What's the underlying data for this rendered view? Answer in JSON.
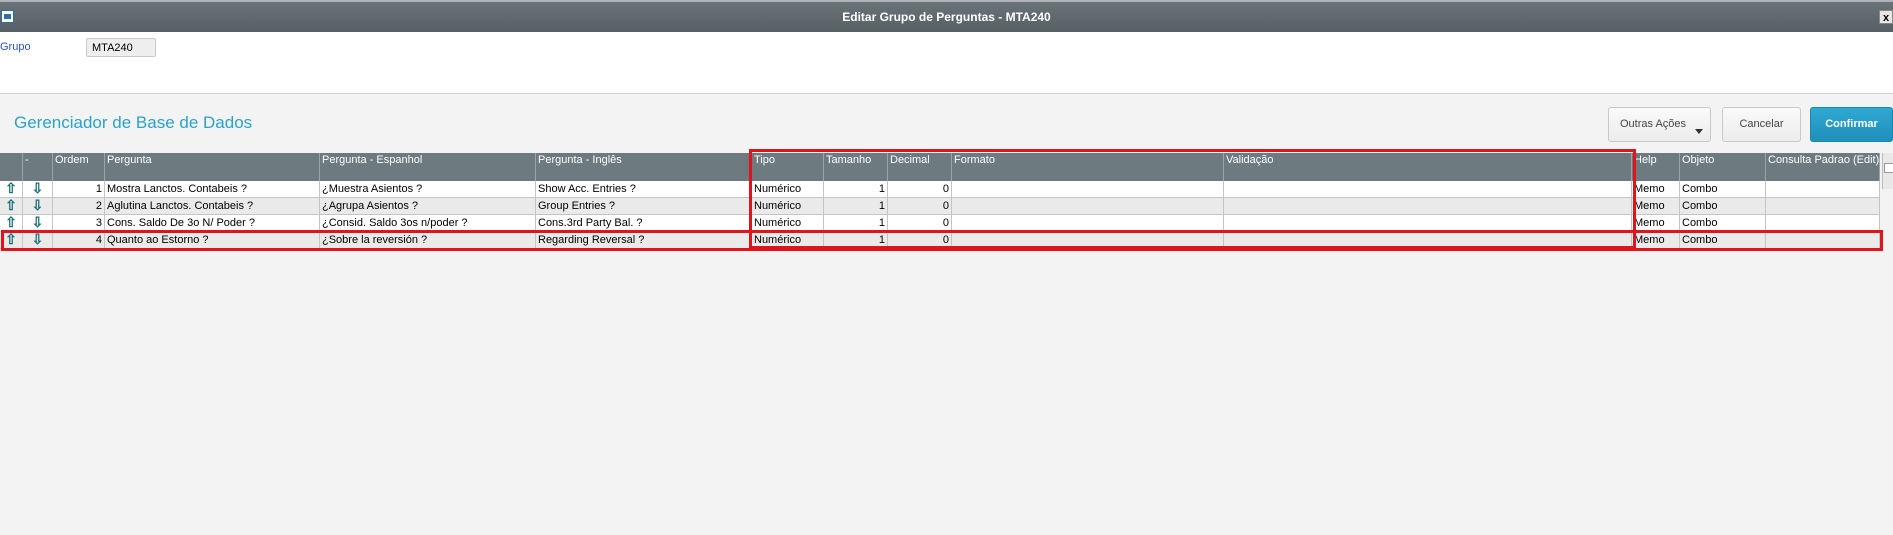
{
  "window": {
    "title": "Editar Grupo de Perguntas - MTA240",
    "close_label": "x"
  },
  "group": {
    "label": "Grupo",
    "value": "MTA240"
  },
  "heading": "Gerenciador de Base de Dados",
  "actions": {
    "outras": "Outras Ações",
    "cancelar": "Cancelar",
    "confirmar": "Confirmar"
  },
  "columns": [
    "",
    "-",
    "Ordem",
    "Pergunta",
    "Pergunta - Espanhol",
    "Pergunta - Inglês",
    "Tipo",
    "Tamanho",
    "Decimal",
    "Formato",
    "Validação",
    "Help",
    "Objeto",
    "Consulta Padrao (Edit)"
  ],
  "rows": [
    {
      "up": "⇧",
      "down": "⇩",
      "ordem": "1",
      "pergunta": "Mostra Lanctos. Contabeis ?",
      "espanhol": "¿Muestra Asientos ?",
      "ingles": "Show Acc. Entries ?",
      "tipo": "Numérico",
      "tamanho": "1",
      "decimal": "0",
      "formato": "",
      "validacao": "",
      "help": "Memo",
      "objeto": "Combo",
      "consulta": ""
    },
    {
      "up": "⇧",
      "down": "⇩",
      "ordem": "2",
      "pergunta": "Aglutina Lanctos. Contabeis ?",
      "espanhol": "¿Agrupa Asientos ?",
      "ingles": "Group Entries ?",
      "tipo": "Numérico",
      "tamanho": "1",
      "decimal": "0",
      "formato": "",
      "validacao": "",
      "help": "Memo",
      "objeto": "Combo",
      "consulta": ""
    },
    {
      "up": "⇧",
      "down": "⇩",
      "ordem": "3",
      "pergunta": "Cons. Saldo De 3o N/ Poder ?",
      "espanhol": "¿Consid. Saldo 3os n/poder ?",
      "ingles": "Cons.3rd Party Bal. ?",
      "tipo": "Numérico",
      "tamanho": "1",
      "decimal": "0",
      "formato": "",
      "validacao": "",
      "help": "Memo",
      "objeto": "Combo",
      "consulta": ""
    },
    {
      "up": "⇧",
      "down": "⇩",
      "ordem": "4",
      "pergunta": "Quanto ao Estorno  ?",
      "espanhol": "¿Sobre la reversión ?",
      "ingles": "Regarding Reversal  ?",
      "tipo": "Numérico",
      "tamanho": "1",
      "decimal": "0",
      "formato": "",
      "validacao": "",
      "help": "Memo",
      "objeto": "Combo",
      "consulta": ""
    }
  ],
  "colors": {
    "accent": "#2aa3c7",
    "header_bg": "#6d7a80",
    "highlight": "#e0141c",
    "link": "#2454c6"
  }
}
